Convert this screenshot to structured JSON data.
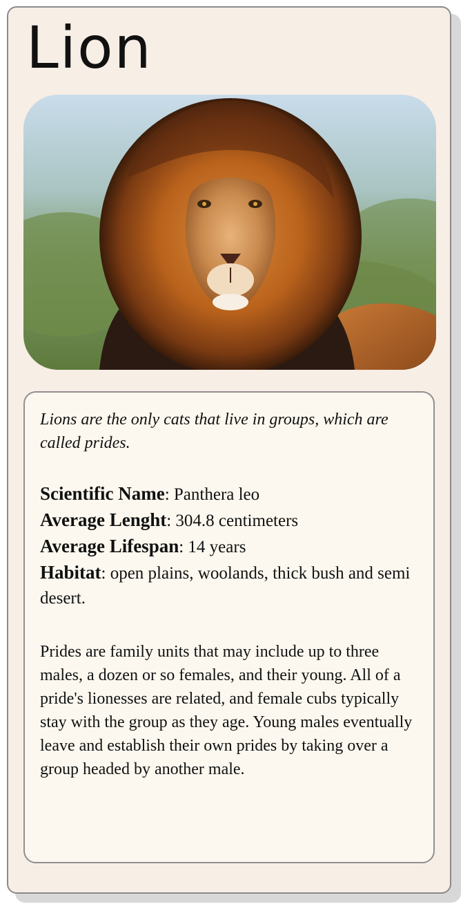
{
  "card": {
    "title": "Lion",
    "image_alt": "lion-photo",
    "tagline": "Lions are the only cats that live in groups, which are called prides.",
    "facts": [
      {
        "label": "Scientific Name",
        "value": ": Panthera leo"
      },
      {
        "label": "Average Lenght",
        "value": ": 304.8 centimeters"
      },
      {
        "label": "Average Lifespan",
        "value": ": 14 years"
      },
      {
        "label": "Habitat",
        "value": ": open plains, woolands, thick bush and semi desert."
      }
    ],
    "description": "Prides are family units that may include up to three males, a dozen or so females, and their young. All of a pride's lionesses are related, and female cubs typically stay with the group as they age. Young males eventually leave and establish their own prides by taking over a group headed by another male."
  },
  "colors": {
    "card_bg": "#f7eee6",
    "info_bg": "#fcf8ef",
    "border": "#8a8a8a",
    "shadow": "#d8d8d8"
  }
}
